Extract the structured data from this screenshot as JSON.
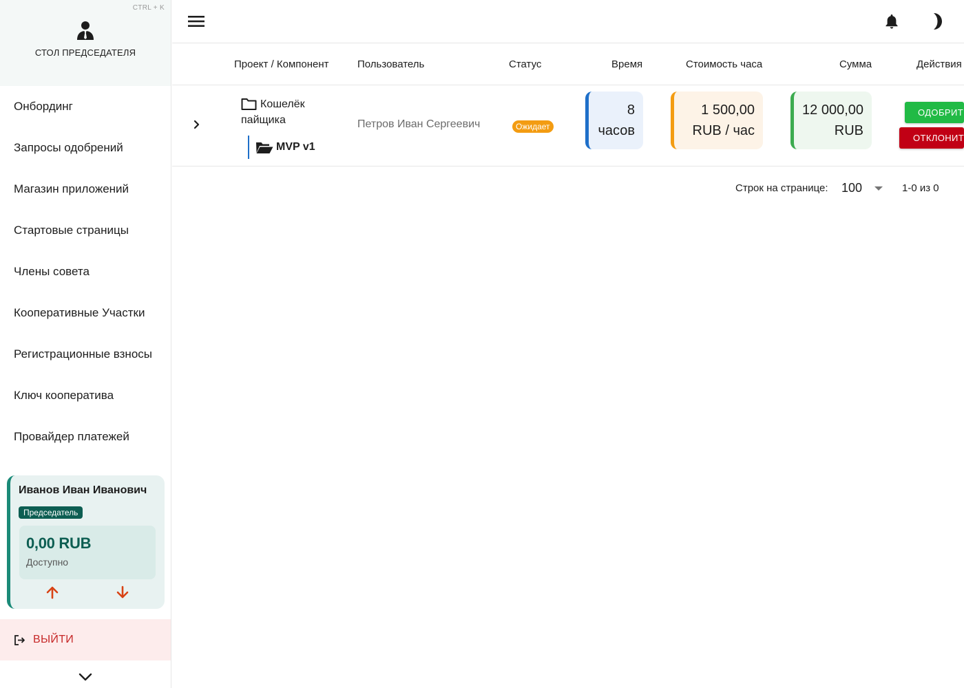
{
  "sidebar": {
    "shortcut": "CTRL + K",
    "desk_title": "СТОЛ ПРЕДСЕДАТЕЛЯ",
    "desk_icon": "user-tie-icon",
    "items": [
      {
        "label": "Онбординг"
      },
      {
        "label": "Запросы одобрений"
      },
      {
        "label": "Магазин приложений"
      },
      {
        "label": "Стартовые страницы"
      },
      {
        "label": "Члены совета"
      },
      {
        "label": "Кооперативные Участки"
      },
      {
        "label": "Регистрационные взносы"
      },
      {
        "label": "Ключ кооператива"
      },
      {
        "label": "Провайдер платежей"
      }
    ],
    "user": {
      "name": "Иванов Иван Иванович",
      "role": "Председатель",
      "balance": "0,00 RUB",
      "balance_label": "Доступно"
    },
    "logout_label": "ВЫЙТИ"
  },
  "topbar": {
    "icons": [
      "menu-icon",
      "bell-icon",
      "moon-icon"
    ]
  },
  "table": {
    "headers": {
      "project": "Проект / Компонент",
      "user": "Пользователь",
      "status": "Статус",
      "time": "Время",
      "rate": "Стоимость часа",
      "sum": "Сумма",
      "actions": "Действия"
    },
    "rows": [
      {
        "project": "Кошелёк пайщика",
        "component": "MVP v1",
        "user": "Петров Иван Сергеевич",
        "status": "Ожидает",
        "time_value": "8",
        "time_unit": "часов",
        "rate_value": "1 500,00",
        "rate_unit": "RUB / час",
        "sum_value": "12 000,00",
        "sum_unit": "RUB",
        "approve_label": "ОДОБРИТЬ",
        "reject_label": "ОТКЛОНИТЬ"
      }
    ],
    "pagination": {
      "rows_label": "Строк на странице:",
      "rows_per_page": "100",
      "range": "1-0 из 0"
    }
  },
  "colors": {
    "accent_teal": "#0d5e52",
    "status_pending": "#f39c12",
    "approve": "#21ba45",
    "reject": "#c10015",
    "time_accent": "#1e6fc9",
    "sum_accent": "#3cab4f"
  }
}
